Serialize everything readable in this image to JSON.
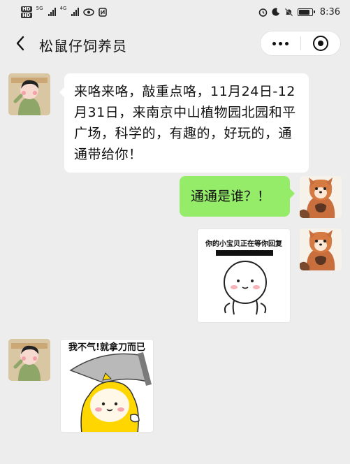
{
  "status_bar": {
    "hd1": "HD",
    "hd2": "HD",
    "network1": "5G",
    "network2": "4G",
    "time": "8:36",
    "battery_level": 0.85,
    "icons": [
      "alarm-icon",
      "moon-icon",
      "mute-icon",
      "battery-icon"
    ]
  },
  "nav": {
    "title": "松鼠仔饲养员",
    "back_icon": "chevron-left-icon",
    "more_icon": "more-dots-icon",
    "close_icon": "target-icon"
  },
  "messages": [
    {
      "side": "left",
      "type": "text",
      "text": "来咯来咯，敲重点咯，11月24日-12月31日，来南京中山植物园北园和平广场，科学的，有趣的，好玩的，通通带给你！"
    },
    {
      "side": "right",
      "type": "text",
      "text": "通通是谁？！"
    },
    {
      "side": "right",
      "type": "sticker",
      "caption": "你的小宝贝正在等你回复",
      "sticker": "waiting-person-sticker"
    },
    {
      "side": "left",
      "type": "sticker",
      "caption": "我不气!就拿刀而已",
      "sticker": "yellow-raincoat-knife-sticker"
    }
  ],
  "colors": {
    "background": "#ededed",
    "bubble_mine": "#95ec69",
    "bubble_theirs": "#ffffff"
  }
}
